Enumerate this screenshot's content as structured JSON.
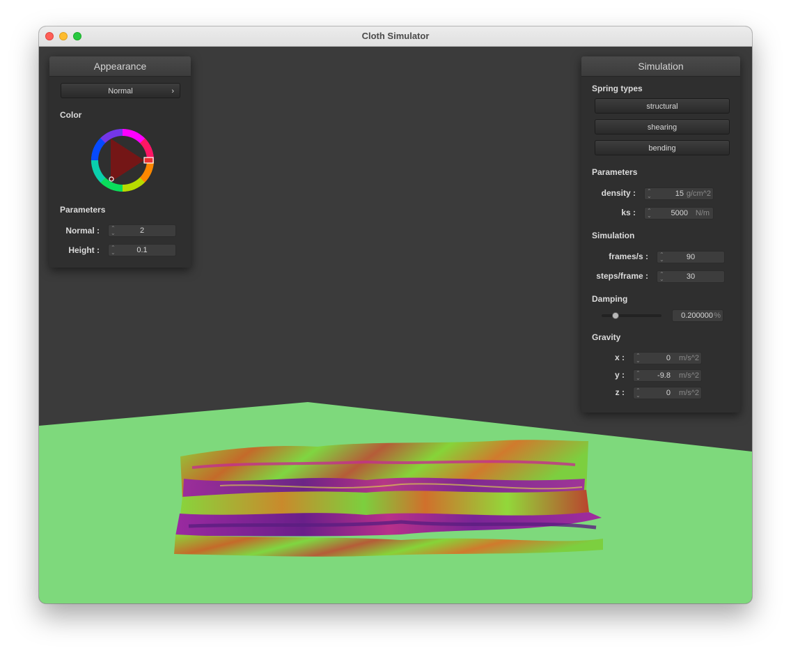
{
  "window": {
    "title": "Cloth Simulator"
  },
  "appearance": {
    "header": "Appearance",
    "shader_select": "Normal",
    "color_label": "Color",
    "parameters_label": "Parameters",
    "normal_label": "Normal :",
    "normal_value": "2",
    "height_label": "Height :",
    "height_value": "0.1"
  },
  "simulation": {
    "header": "Simulation",
    "spring_types_label": "Spring types",
    "spring_buttons": [
      "structural",
      "shearing",
      "bending"
    ],
    "parameters_label": "Parameters",
    "density_label": "density :",
    "density_value": "15",
    "density_unit": "g/cm^2",
    "ks_label": "ks :",
    "ks_value": "5000",
    "ks_unit": "N/m",
    "simulation_label": "Simulation",
    "fps_label": "frames/s :",
    "fps_value": "90",
    "steps_label": "steps/frame :",
    "steps_value": "30",
    "damping_label": "Damping",
    "damping_value": "0.200000",
    "damping_unit": "%",
    "damping_fraction": 0.2,
    "gravity_label": "Gravity",
    "gx_label": "x :",
    "gx_value": "0",
    "gy_label": "y :",
    "gy_value": "-9.8",
    "gz_label": "z :",
    "gz_value": "0",
    "gravity_unit": "m/s^2"
  },
  "colors": {
    "ground": "#7ed97c",
    "background": "#3b3b3b",
    "panel": "#2f2f2f"
  }
}
